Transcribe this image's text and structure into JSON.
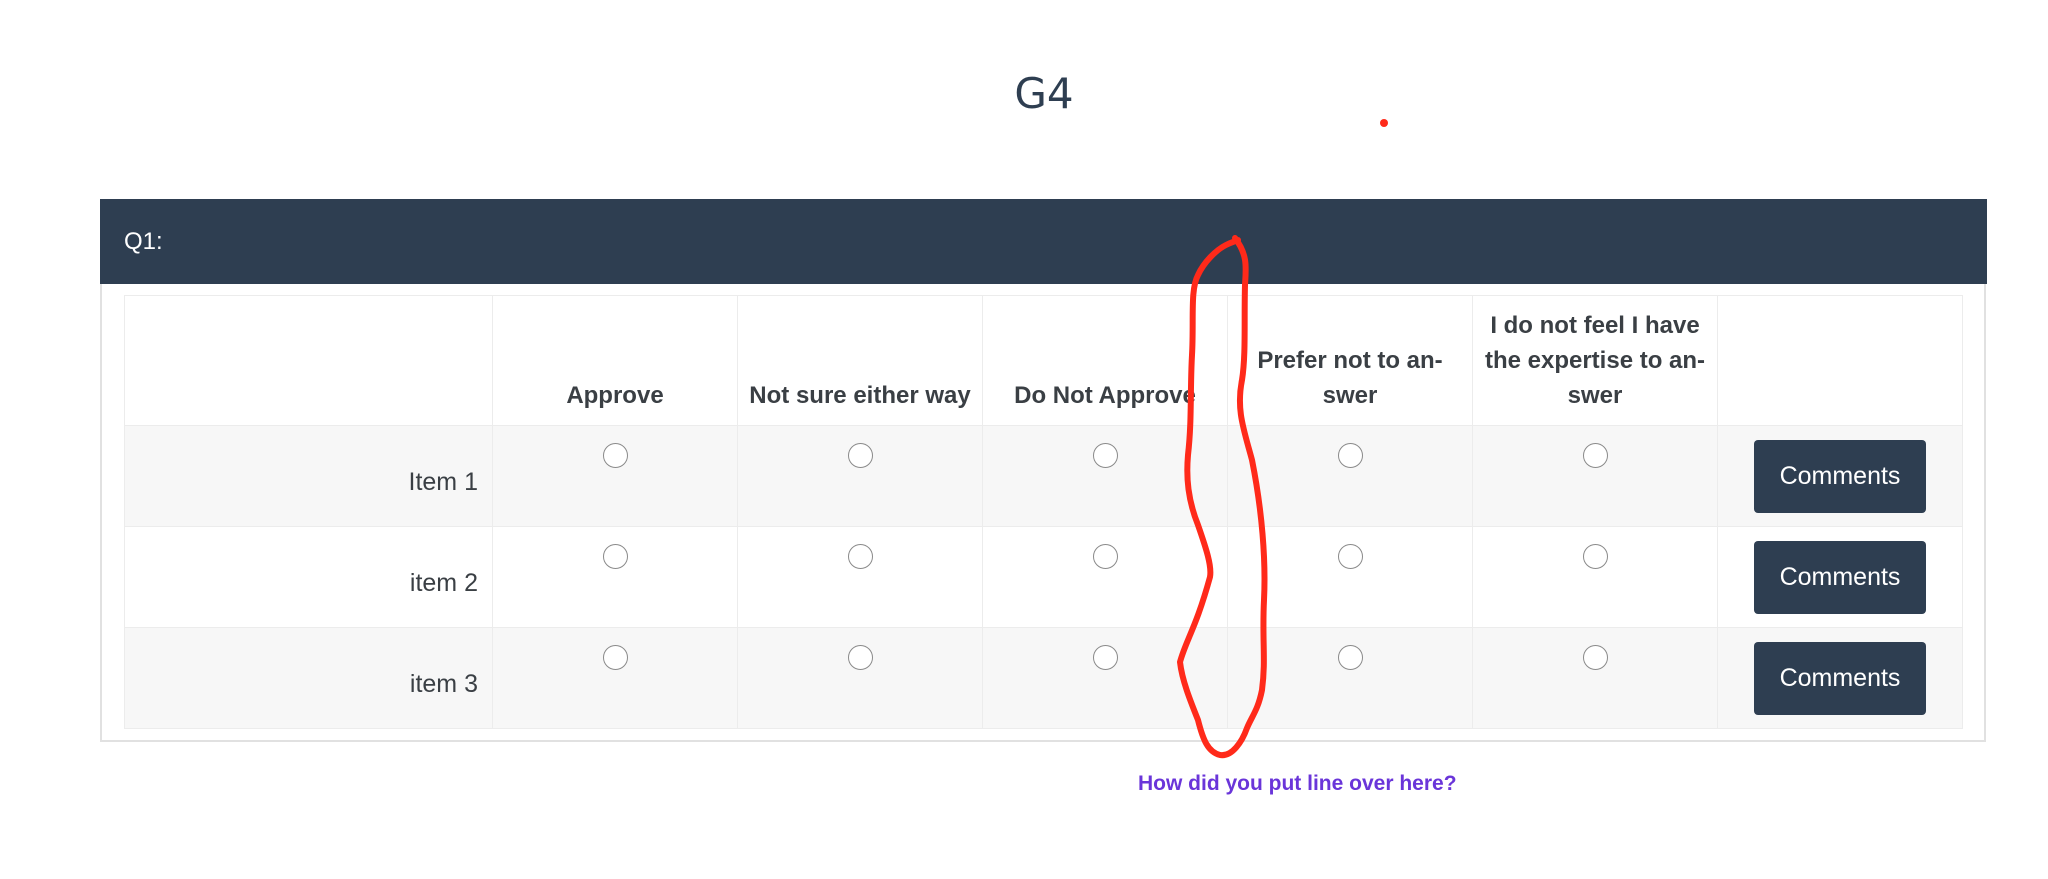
{
  "page": {
    "title": "G4"
  },
  "question": {
    "label": "Q1:",
    "columns": [
      "Approve",
      "Not sure either way",
      "Do Not Approve",
      "Prefer not to an-swer",
      "I do not feel I have the expertise to an-swer"
    ],
    "rows": [
      {
        "label": "Item 1",
        "button": "Comments"
      },
      {
        "label": "item 2",
        "button": "Comments"
      },
      {
        "label": "item 3",
        "button": "Comments"
      }
    ]
  },
  "annotation": {
    "note": "How did you put line over here?",
    "color": "#ff2a1a",
    "note_color": "#6a35d9"
  },
  "colors": {
    "header_bg": "#2e3e51",
    "button_bg": "#2e3e51",
    "title": "#2e3e51"
  }
}
